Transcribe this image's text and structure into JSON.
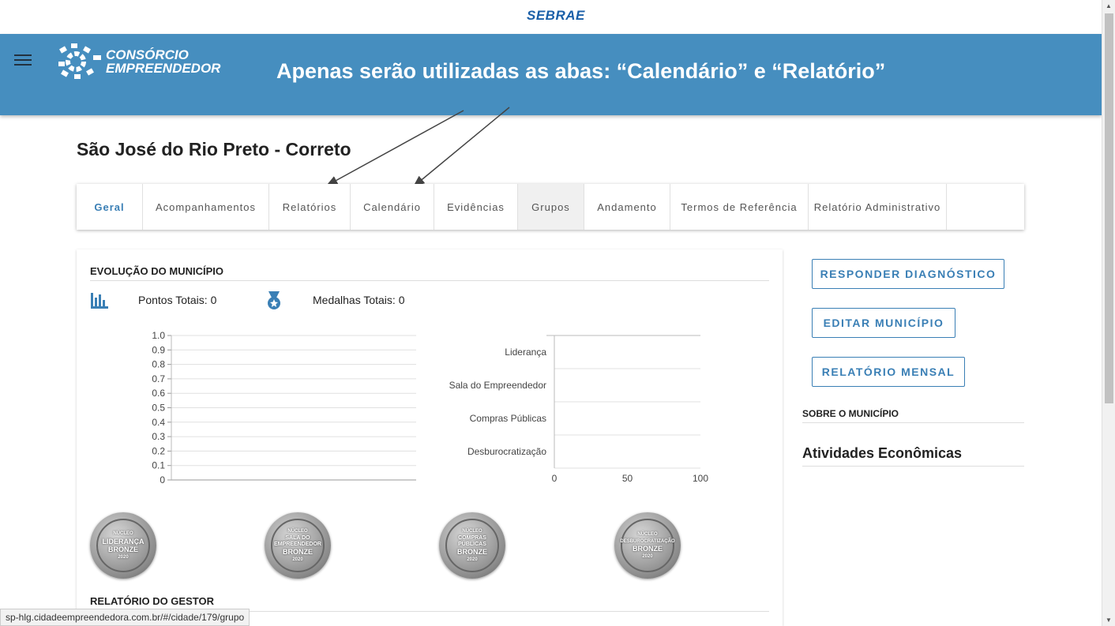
{
  "sebrae_logo": "SEBRAE",
  "header": {
    "brand_line1": "CONSÓRCIO",
    "brand_line2": "EMPREENDEDOR",
    "banner": "Apenas serão utilizadas as abas: “Calendário” e “Relatório”",
    "color": "#468ebf"
  },
  "city_title": "São José do Rio Preto - Correto",
  "tabs": [
    {
      "label": "Geral"
    },
    {
      "label": "Acompanhamentos"
    },
    {
      "label": "Relatórios"
    },
    {
      "label": "Calendário"
    },
    {
      "label": "Evidências"
    },
    {
      "label": "Grupos"
    },
    {
      "label": "Andamento"
    },
    {
      "label": "Termos de Referência"
    },
    {
      "label": "Relatório Administrativo"
    }
  ],
  "evolution": {
    "title": "EVOLUÇÃO DO MUNICÍPIO",
    "points_label": "Pontos Totais: 0",
    "medals_label": "Medalhas Totais: 0"
  },
  "chart_data": [
    {
      "type": "line",
      "ylim": [
        0,
        1.0
      ],
      "y_ticks": [
        "1.0",
        "0.9",
        "0.8",
        "0.7",
        "0.6",
        "0.5",
        "0.4",
        "0.3",
        "0.2",
        "0.1",
        "0"
      ],
      "series": []
    },
    {
      "type": "bar",
      "orientation": "horizontal",
      "categories": [
        "Liderança",
        "Sala do Empreendedor",
        "Compras Públicas",
        "Desburocratização"
      ],
      "values": [
        0,
        0,
        0,
        0
      ],
      "xlim": [
        0,
        100
      ],
      "x_ticks": [
        "0",
        "50",
        "100"
      ]
    }
  ],
  "medals": [
    {
      "title": "LIDERANÇA",
      "top": "NÚCLEO",
      "level": "BRONZE",
      "year": "2020"
    },
    {
      "title": "SALA DO EMPREENDEDOR",
      "top": "NÚCLEO",
      "level": "BRONZE",
      "year": "2020"
    },
    {
      "title": "COMPRAS PÚBLICAS",
      "top": "NÚCLEO",
      "level": "BRONZE",
      "year": "2020"
    },
    {
      "title": "DESBUROCRATIZAÇÃO",
      "top": "NÚCLEO",
      "level": "BRONZE",
      "year": "2020"
    }
  ],
  "gestor_title": "RELATÓRIO DO GESTOR",
  "actions": {
    "responder": "RESPONDER DIAGNÓSTICO",
    "editar": "EDITAR MUNICÍPIO",
    "relatorio": "RELATÓRIO MENSAL"
  },
  "sidebar": {
    "about_title": "SOBRE O MUNICÍPIO",
    "activities_title": "Atividades Econômicas"
  },
  "status_url": "sp-hlg.cidadeempreendedora.com.br/#/cidade/179/grupo"
}
